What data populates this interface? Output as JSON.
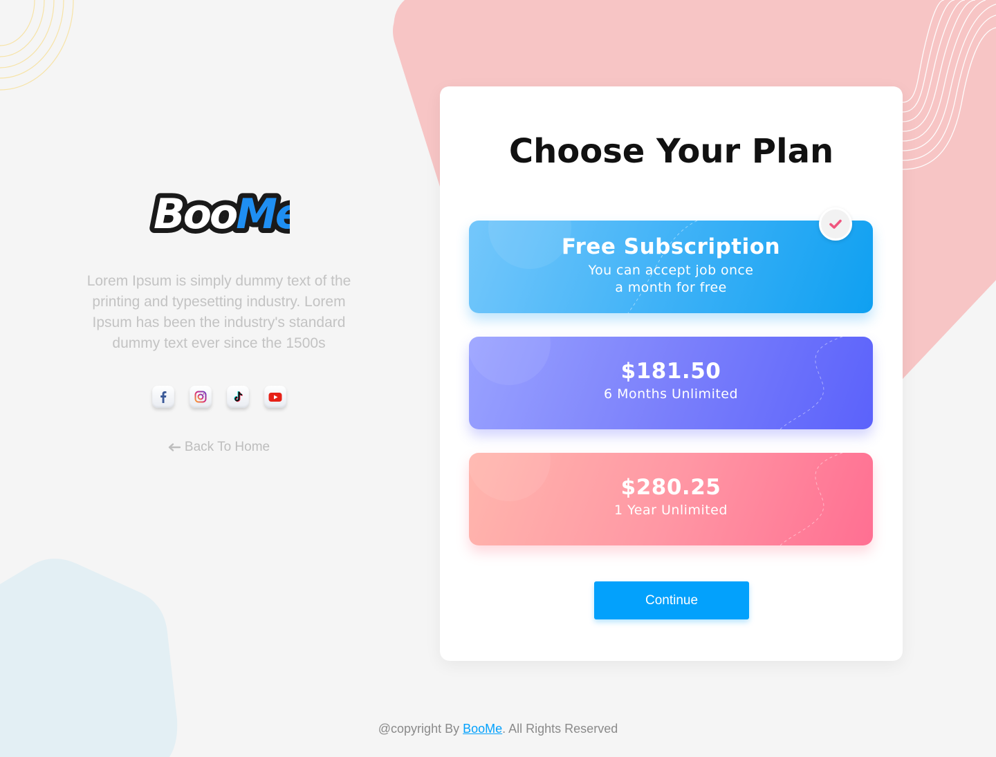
{
  "brand": {
    "name": "BooMe",
    "name_part1": "Boo",
    "name_part2": "Me"
  },
  "left": {
    "tagline": "Lorem Ipsum is simply dummy text of the printing and typesetting industry. Lorem Ipsum has been the industry's standard dummy text ever since the 1500s",
    "socials": [
      {
        "name": "facebook",
        "icon": "facebook-icon",
        "color": "#3b5998"
      },
      {
        "name": "instagram",
        "icon": "instagram-icon",
        "color": "#c13584"
      },
      {
        "name": "tiktok",
        "icon": "tiktok-icon",
        "color": "#111111"
      },
      {
        "name": "youtube",
        "icon": "youtube-icon",
        "color": "#e62117"
      }
    ],
    "back_label": "Back To Home",
    "back_icon": "arrow-left-icon"
  },
  "card": {
    "title": "Choose Your Plan",
    "plans": [
      {
        "title": "Free Subscription",
        "desc_line1": "You can accept job once",
        "desc_line2": "a month for free",
        "selected": true
      },
      {
        "title": "$181.50",
        "desc": "6 Months Unlimited",
        "selected": false
      },
      {
        "title": "$280.25",
        "desc": "1 Year Unlimited",
        "selected": false
      }
    ],
    "selected_icon": "check-icon",
    "continue_label": "Continue"
  },
  "footer": {
    "prefix": "@copyright By ",
    "link": "BooMe",
    "suffix": ". All Rights Reserved"
  },
  "colors": {
    "accent": "#03a1fc",
    "pink_blob": "#f7c5c5",
    "blue_blob": "#e3eff4",
    "check": "#f0567f"
  }
}
